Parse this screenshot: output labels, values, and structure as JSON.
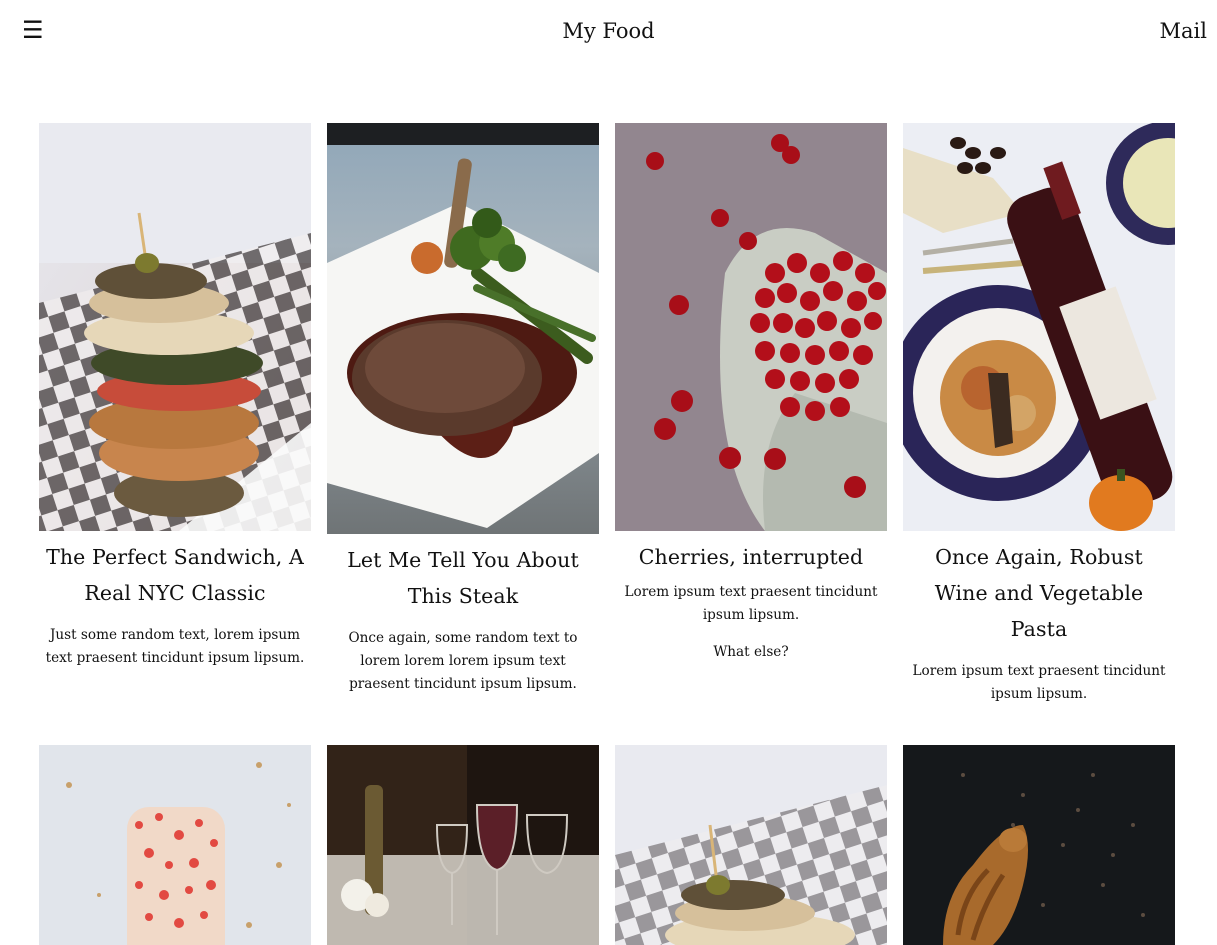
{
  "header": {
    "menu_icon": "☰",
    "title": "My Food",
    "mail_label": "Mail"
  },
  "cards_row1": [
    {
      "title": "The Perfect Sandwich, A Real NYC Classic",
      "text": "Just some random text, lorem ipsum text praesent tincidunt ipsum lipsum.",
      "image": "sandwich-photo"
    },
    {
      "title": "Let Me Tell You About This Steak",
      "text": "Once again, some random text to lorem lorem lorem ipsum text praesent tincidunt ipsum lipsum.",
      "image": "steak-photo"
    },
    {
      "title": "Cherries, interrupted",
      "text": "Lorem ipsum text praesent tincidunt ipsum lipsum.",
      "text2": "What else?",
      "image": "cherries-photo"
    },
    {
      "title": "Once Again, Robust Wine and Vegetable Pasta",
      "text": "Lorem ipsum text praesent tincidunt ipsum lipsum.",
      "image": "wine-pasta-photo"
    }
  ],
  "cards_row2": [
    {
      "image": "popsicle-photo"
    },
    {
      "image": "wine-glasses-photo"
    },
    {
      "image": "sandwich-photo"
    },
    {
      "image": "croissant-photo"
    }
  ],
  "colors": {
    "background": "#ffffff",
    "text": "#111111"
  }
}
